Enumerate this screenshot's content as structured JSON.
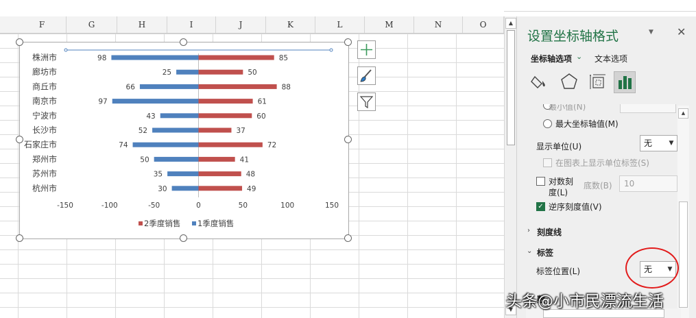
{
  "sheet": {
    "columns": [
      "F",
      "G",
      "H",
      "I",
      "J",
      "K",
      "L",
      "M",
      "N",
      "O"
    ]
  },
  "chart_data": {
    "type": "bar",
    "orientation": "horizontal-butterfly",
    "categories": [
      "株洲市",
      "廊坊市",
      "商丘市",
      "南京市",
      "宁波市",
      "长沙市",
      "石家庄市",
      "郑州市",
      "苏州市",
      "杭州市"
    ],
    "series": [
      {
        "name": "2季度销售",
        "values": [
          85,
          50,
          88,
          61,
          60,
          37,
          72,
          41,
          48,
          49
        ],
        "color": "#c0504d",
        "side": "positive"
      },
      {
        "name": "1季度销售",
        "values": [
          98,
          25,
          66,
          97,
          43,
          52,
          74,
          50,
          35,
          30
        ],
        "color": "#4f81bd",
        "side": "negative"
      }
    ],
    "xlim": [
      -150,
      150
    ],
    "x_ticks": [
      "-150",
      "-100",
      "-50",
      "0",
      "50",
      "100",
      "150"
    ],
    "tick_values": [
      -150,
      -100,
      -50,
      0,
      50,
      100,
      150
    ],
    "legend_position": "bottom",
    "grid": false
  },
  "chart_buttons": [
    "plus-icon",
    "brush-icon",
    "filter-icon"
  ],
  "pane": {
    "title": "设置坐标轴格式",
    "tab_axis_options": "坐标轴选项",
    "tab_text_options": "文本选项",
    "partial_row": "    最小值(N)",
    "max_axis_value": "最大坐标轴值(M)",
    "display_units_label": "显示单位(U)",
    "display_units_value": "无",
    "show_units_label": "在图表上显示单位标签(S)",
    "log_scale_label_1": "对数刻",
    "log_scale_label_2": "度(L)",
    "base_label": "底数(B)",
    "base_value": "10",
    "reverse_order_label": "逆序刻度值(V)",
    "tick_marks_section": "刻度线",
    "labels_section": "标签",
    "label_position_label": "标签位置(L)",
    "label_position_value": "无",
    "numbers_section_partial": "数"
  },
  "watermark": "头条@小市民漂流生活"
}
